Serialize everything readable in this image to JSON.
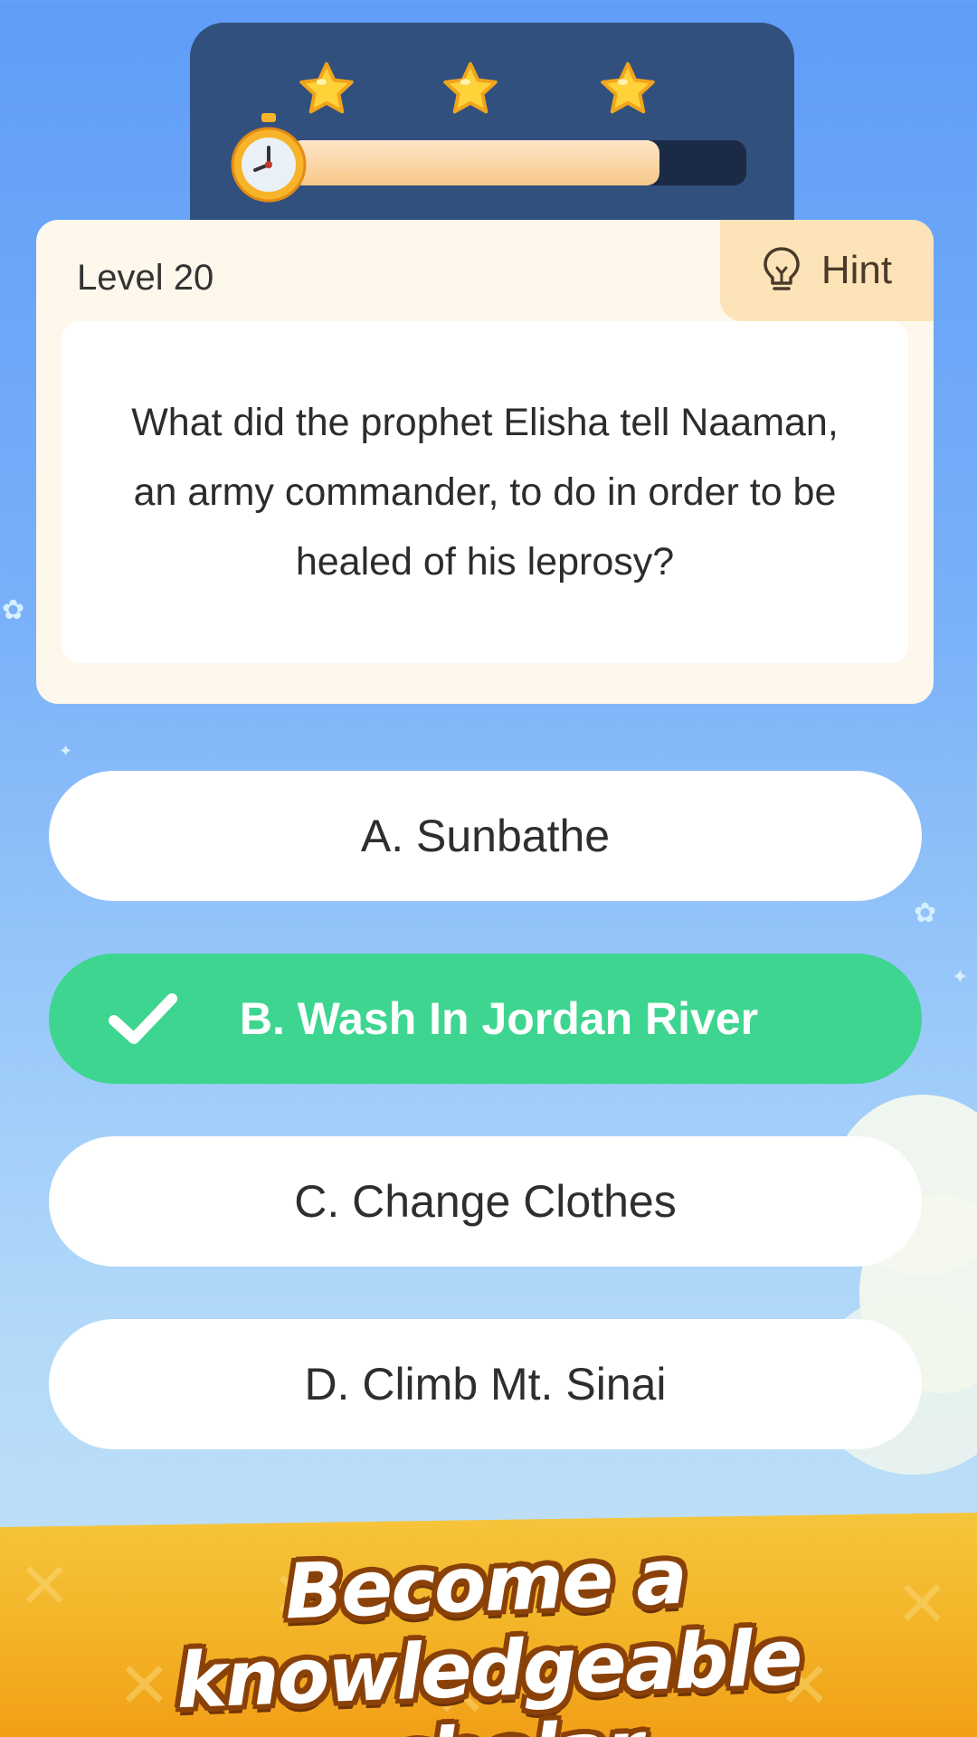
{
  "timer": {
    "stars": [
      "star-icon",
      "star-icon",
      "star-icon"
    ],
    "progress": 0.81
  },
  "question_card": {
    "level": "Level 20",
    "hint_label": "Hint",
    "question_lines": [
      "What did the prophet Elisha tell Naaman,",
      "an army commander, to do in order to be",
      "healed of his leprosy?"
    ]
  },
  "answers": [
    {
      "label": "A. Sunbathe",
      "state": "default"
    },
    {
      "label": "B. Wash In Jordan River",
      "state": "correct"
    },
    {
      "label": "C. Change Clothes",
      "state": "default"
    },
    {
      "label": "D. Climb Mt. Sinai",
      "state": "default"
    }
  ],
  "banner": {
    "line1": "Become a knowledgeable",
    "line2": "scholar"
  },
  "colors": {
    "panel": "#32507e",
    "card": "#fdf7ec",
    "hint_bg": "#fde4b8",
    "correct": "#3dd590",
    "banner": "#f3b326",
    "banner_outline": "#8a4108"
  }
}
